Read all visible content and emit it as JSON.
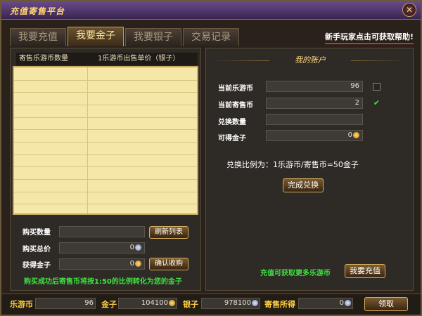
{
  "window": {
    "title": "充值寄售平台"
  },
  "tabs": [
    {
      "label": "我要充值",
      "active": false
    },
    {
      "label": "我要金子",
      "active": true
    },
    {
      "label": "我要银子",
      "active": false
    },
    {
      "label": "交易记录",
      "active": false
    }
  ],
  "help_link": "新手玩家点击可获取帮助!",
  "listing": {
    "columns": [
      "寄售乐游币数量",
      "1乐游币出售单价（银子）"
    ],
    "rows": 12
  },
  "purchase": {
    "qty_label": "购买数量",
    "qty_value": "",
    "total_label": "购买总价",
    "total_value": "0",
    "gold_label": "获得金子",
    "gold_value": "0",
    "refresh_button": "刷新列表",
    "confirm_button": "确认收购",
    "notice": "购买成功后寄售币将按1:50的比例转化为您的金子"
  },
  "account": {
    "header": "我的账户",
    "current_coin_label": "当前乐游币",
    "current_coin_value": "96",
    "current_coin_checked": false,
    "consign_coin_label": "当前寄售币",
    "consign_coin_value": "2",
    "consign_coin_checked": true,
    "exchange_qty_label": "兑换数量",
    "exchange_qty_value": "",
    "gold_gain_label": "可得金子",
    "gold_gain_value": "0",
    "ratio_text": "兑换比例为：1乐游币/寄售币=50金子",
    "exchange_button": "完成兑换",
    "recharge_tip": "充值可获取更多乐游币",
    "recharge_button": "我要充值"
  },
  "footer": {
    "coin_label": "乐游币",
    "coin_value": "96",
    "gold_label": "金子",
    "gold_value": "104100",
    "silver_label": "银子",
    "silver_value": "978100",
    "consign_label": "寄售所得",
    "consign_value": "0",
    "claim_button": "领取"
  },
  "icons": {
    "gold_coin": "gold-coin-icon",
    "silver_coin": "silver-coin-icon",
    "close": "close-icon"
  }
}
